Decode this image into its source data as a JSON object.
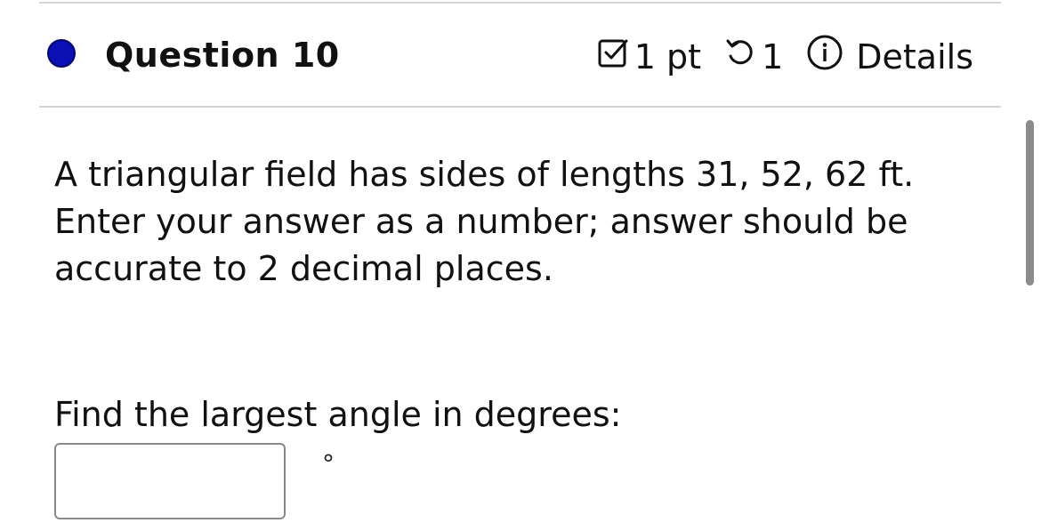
{
  "question": {
    "title": "Question 10",
    "status_color": "#0a10b4",
    "points_label": "1 pt",
    "attempts_label": "1",
    "details_label": "Details",
    "icons": {
      "status": "status-dot-icon",
      "points": "checkbox-icon",
      "attempts": "retry-icon",
      "details": "info-icon"
    }
  },
  "body": {
    "text": "A triangular field has sides of lengths 31, 52, 62 ft. Enter your answer as a number; answer should be accurate to 2 decimal places.",
    "prompt": "Find the largest angle in degrees:",
    "answer_value": "",
    "unit_symbol": "°"
  }
}
